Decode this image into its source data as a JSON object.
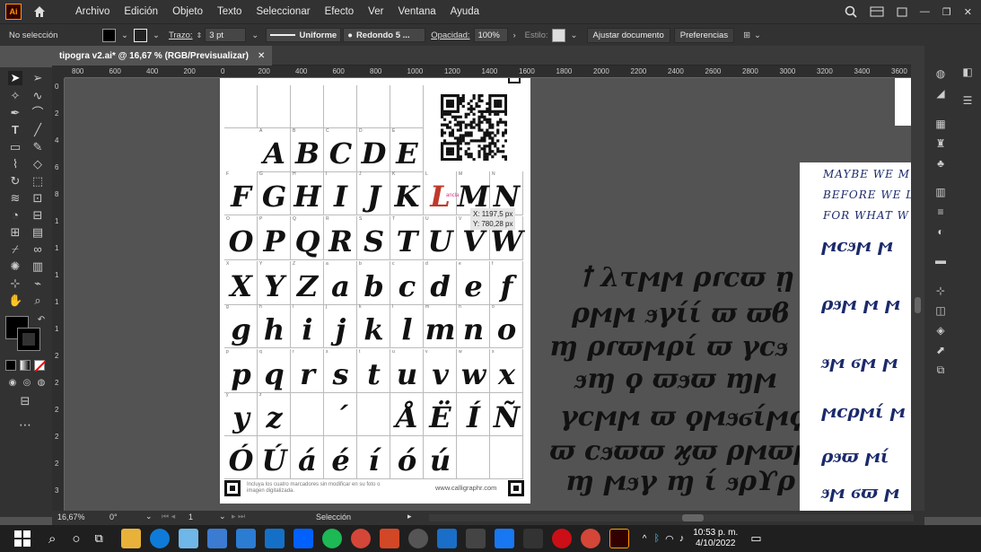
{
  "app": {
    "logo": "Ai"
  },
  "menu": [
    "Archivo",
    "Edición",
    "Objeto",
    "Texto",
    "Seleccionar",
    "Efecto",
    "Ver",
    "Ventana",
    "Ayuda"
  ],
  "control": {
    "selection": "No selección",
    "stroke_label": "Trazo:",
    "stroke_value": "3 pt",
    "profile": "Uniforme",
    "brush": "Redondo 5 ...",
    "opacity_label": "Opacidad:",
    "opacity_value": "100%",
    "style_label": "Estilo:",
    "adjust_btn": "Ajustar documento",
    "prefs_btn": "Preferencias"
  },
  "tab": {
    "title": "tipogra v2.ai* @ 16,67 % (RGB/Previsualizar)"
  },
  "ruler_h": [
    "800",
    "600",
    "400",
    "200",
    "0",
    "200",
    "400",
    "600",
    "800",
    "1000",
    "1200",
    "1400",
    "1600",
    "1800",
    "2000",
    "2200",
    "2400",
    "2600",
    "2800",
    "3000",
    "3200",
    "3400",
    "3600"
  ],
  "ruler_v": [
    "0",
    "2",
    "4",
    "6",
    "8",
    "1",
    "1",
    "1",
    "1",
    "1",
    "2",
    "2",
    "2",
    "2",
    "2",
    "3"
  ],
  "sheet": {
    "rows": [
      {
        "letters": [
          "A",
          "B",
          "C",
          "D",
          "E"
        ],
        "labels": [
          "A",
          "B",
          "C",
          "D",
          "E"
        ]
      },
      {
        "letters": [
          "F",
          "G",
          "H",
          "I",
          "J",
          "K",
          "L",
          "M",
          "N"
        ],
        "labels": [
          "F",
          "G",
          "H",
          "I",
          "J",
          "K",
          "L",
          "M",
          "N"
        ]
      },
      {
        "letters": [
          "O",
          "P",
          "Q",
          "R",
          "S",
          "T",
          "U",
          "V",
          "W"
        ],
        "labels": [
          "O",
          "P",
          "Q",
          "R",
          "S",
          "T",
          "U",
          "V",
          "W"
        ]
      },
      {
        "letters": [
          "X",
          "Y",
          "Z",
          "a",
          "b",
          "c",
          "d",
          "e",
          "f"
        ],
        "labels": [
          "X",
          "Y",
          "Z",
          "a",
          "b",
          "c",
          "d",
          "e",
          "f"
        ]
      },
      {
        "letters": [
          "g",
          "h",
          "i",
          "j",
          "k",
          "l",
          "m",
          "n",
          "o"
        ],
        "labels": [
          "g",
          "h",
          "i",
          "j",
          "k",
          "l",
          "m",
          "n",
          "o"
        ]
      },
      {
        "letters": [
          "p",
          "q",
          "r",
          "s",
          "t",
          "u",
          "v",
          "w",
          "x"
        ],
        "labels": [
          "p",
          "q",
          "r",
          "s",
          "t",
          "u",
          "v",
          "w",
          "x"
        ]
      },
      {
        "letters": [
          "y",
          "z",
          "",
          "´",
          "",
          "Å",
          "Ë",
          "Í",
          "Ñ"
        ],
        "labels": [
          "y",
          "z",
          "",
          "",
          "",
          "",
          "",
          "",
          ""
        ]
      },
      {
        "letters": [
          "Ó",
          "Ú",
          "á",
          "é",
          "í",
          "ó",
          "ú",
          "",
          ""
        ],
        "labels": [
          "",
          "",
          "",
          "",
          "",
          "",
          "",
          "",
          ""
        ]
      }
    ],
    "footer_note": "Incluya los cuatro marcadores sin modificar en su foto o imagen digitalizada.",
    "footer_url": "www.calligraphr.com",
    "anchor_label": "ancla"
  },
  "tooltip": {
    "x": "X: 1197,5 px",
    "y": "Y: 780,28 px"
  },
  "status": {
    "zoom": "16,67%",
    "rotation": "0°",
    "page": "1",
    "mode": "Selección"
  },
  "clock": {
    "time": "10:53 p. m.",
    "date": "4/10/2022"
  },
  "right_text": [
    "MAYBE WE M",
    "BEFORE WE LE",
    "FOR WHAT W"
  ],
  "colors": {
    "ui_dark": "#323232",
    "canvas": "#535353",
    "accent_ai": "#ff9a00",
    "script_blue": "#1b2a6b"
  }
}
